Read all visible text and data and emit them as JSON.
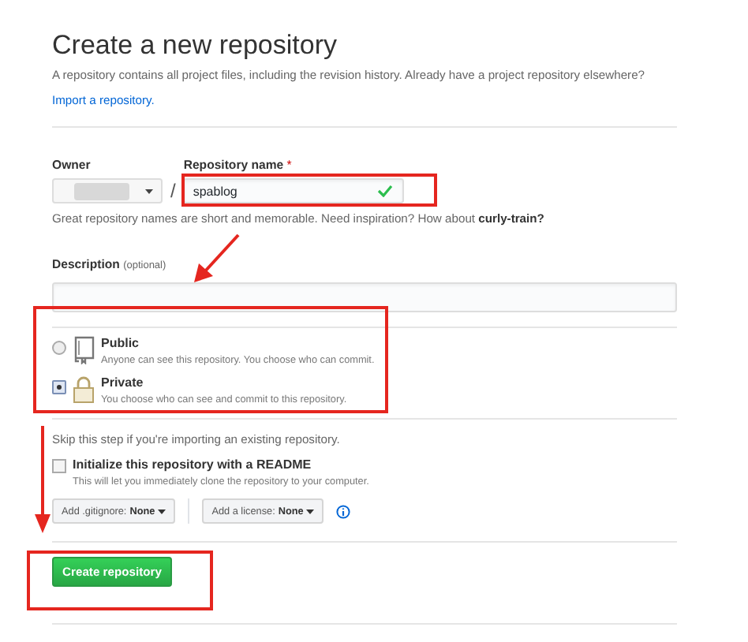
{
  "title": "Create a new repository",
  "intro": {
    "text": "A repository contains all project files, including the revision history. Already have a project repository elsewhere?",
    "link": "Import a repository."
  },
  "owner": {
    "label": "Owner",
    "separator": "/"
  },
  "repo_name": {
    "label": "Repository name",
    "required_mark": "*",
    "value": "spablog",
    "valid": true
  },
  "name_hint": {
    "text": "Great repository names are short and memorable. Need inspiration? How about",
    "suggestion": "curly-train?"
  },
  "description": {
    "label": "Description",
    "note": "(optional)"
  },
  "visibility": [
    {
      "kind": "public",
      "label": "Public",
      "text": "Anyone can see this repository. You choose who can commit.",
      "selected": false
    },
    {
      "kind": "private",
      "label": "Private",
      "text": "You choose who can see and commit to this repository.",
      "selected": true
    }
  ],
  "skip_note": "Skip this step if you're importing an existing repository.",
  "readme": {
    "label": "Initialize this repository with a README",
    "text": "This will let you immediately clone the repository to your computer.",
    "checked": false
  },
  "dropdowns": [
    {
      "label": "Add .gitignore:",
      "value": "None"
    },
    {
      "label": "Add a license:",
      "value": "None"
    }
  ],
  "submit": "Create repository"
}
